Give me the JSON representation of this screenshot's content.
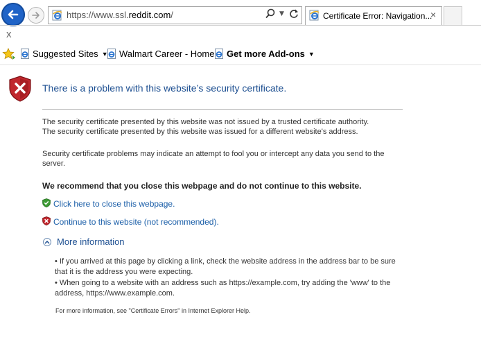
{
  "browser": {
    "address": {
      "prefix": "https://www.ssl.",
      "domain": "reddit.com",
      "suffix": "/"
    },
    "tab": {
      "title": "Certificate Error: Navigation...",
      "close": "×"
    },
    "close_mark": "x",
    "favorites": [
      {
        "label": "Suggested Sites",
        "has_dropdown": true
      },
      {
        "label": "Walmart Career - Home",
        "has_dropdown": false
      },
      {
        "label": "Get more Add-ons",
        "has_dropdown": true,
        "bold": true
      }
    ],
    "icons": {
      "back": "back-arrow-icon",
      "forward": "forward-arrow-icon",
      "search": "search-icon",
      "refresh": "refresh-icon",
      "favorites": "favorites-star-icon",
      "page": "ie-page-icon"
    },
    "colors": {
      "back_button": "#1f63c7",
      "title_blue": "#1d4f91",
      "link_blue": "#1a5ea8"
    }
  },
  "page": {
    "title": "There is a problem with this website’s security certificate.",
    "p1": "The security certificate presented by this website was not issued by a trusted certificate authority.",
    "p2": "The security certificate presented by this website was issued for a different website's address.",
    "p3": "Security certificate problems may indicate an attempt to fool you or intercept any data you send to the server.",
    "recommend": "We recommend that you close this webpage and do not continue to this website.",
    "close_link": "Click here to close this webpage.",
    "continue_link": "Continue to this website (not recommended).",
    "more_info": "More information",
    "bullet1": "•   If you arrived at this page by clicking a link, check the website address in the address bar to be sure that it is the address you were expecting.",
    "bullet2": "•   When going to a website with an address such as https://example.com, try adding the 'www' to the address, https://www.example.com.",
    "footer": "For more information, see \"Certificate Errors\" in Internet Explorer Help."
  }
}
